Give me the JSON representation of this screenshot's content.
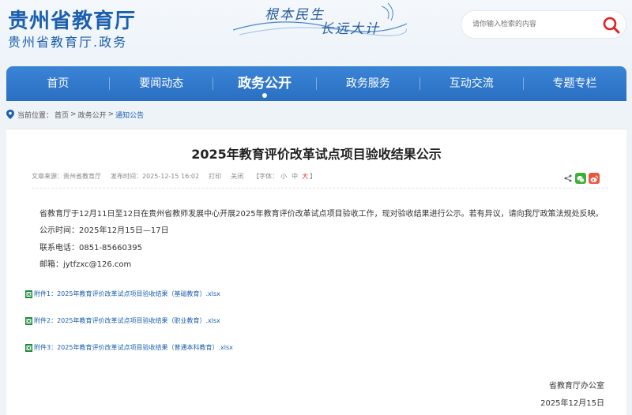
{
  "header": {
    "logo_main": "贵州省教育厅",
    "logo_sub": "贵州省教育厅.政务",
    "slogan_line1": "根本民生",
    "slogan_line2": "长远大计",
    "search_placeholder": "请你输入检索的内容"
  },
  "nav": {
    "items": [
      {
        "label": "首页"
      },
      {
        "label": "要闻动态"
      },
      {
        "label": "政务公开"
      },
      {
        "label": "政务服务"
      },
      {
        "label": "互动交流"
      },
      {
        "label": "专题专栏"
      }
    ],
    "active_index": 2
  },
  "breadcrumb": {
    "prefix": "当前位置：",
    "home": "首页",
    "sep": ">",
    "section": "政务公开",
    "current": "通知公告"
  },
  "article": {
    "title": "2025年教育评价改革试点项目验收结果公示",
    "meta": {
      "source": "文章来源：贵州省教育厅",
      "time": "发布时间：2025-12-15 16:02",
      "print": "打印",
      "close": "关闭",
      "font_prefix": "【字体：",
      "font_small": "小",
      "font_mid": "中",
      "font_big": "大",
      "font_suffix": "】"
    },
    "paragraphs": {
      "p1": "省教育厅于12月11日至12日在贵州省教师发展中心开展2025年教育评价改革试点项目验收工作，现对验收结果进行公示。若有异议，请向我厅政策法规处反映。",
      "p2": "公示时间：2025年12月15日—17日",
      "p3": "联系电话：0851-85660395",
      "p4": "邮箱：jytfzxc@126.com"
    },
    "attachments": [
      {
        "label": "附件1：2025年教育评价改革试点项目验收结果（基础教育）.xlsx"
      },
      {
        "label": "附件2：2025年教育评价改革试点项目验收结果（职业教育）.xlsx"
      },
      {
        "label": "附件3：2025年教育评价改革试点项目验收结果（普通本科教育）.xlsx"
      }
    ],
    "signature": {
      "org": "省教育厅办公室",
      "date": "2025年12月15日"
    }
  },
  "colors": {
    "brand": "#1b5fae",
    "nav_bg": "#2f78cc",
    "accent_red": "#e03131"
  }
}
